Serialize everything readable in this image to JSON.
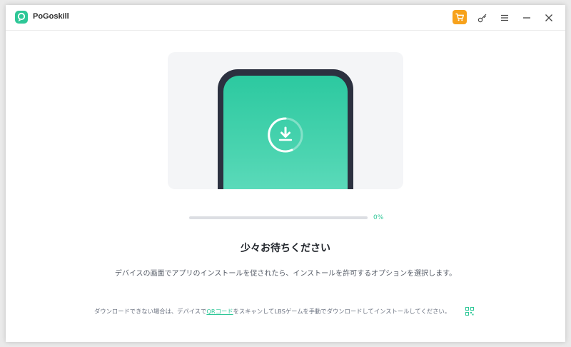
{
  "app": {
    "title": "PoGoskill"
  },
  "titlebar": {
    "icons": [
      "cart-icon",
      "key-icon",
      "menu-icon",
      "minimize-icon",
      "close-icon"
    ],
    "accent_cart": "#f7a21b"
  },
  "progress": {
    "value": 0,
    "text": "0%"
  },
  "main": {
    "heading": "少々お待ちください",
    "description": "デバイスの画面でアプリのインストールを促されたら、インストールを許可するオプションを選択します。"
  },
  "footer": {
    "text_before": "ダウンロードできない場合は、デバイスで",
    "link": "QRコード",
    "text_after": "をスキャンしてLBSゲームを手動でダウンロードしてインストールしてください。"
  },
  "colors": {
    "brand": "#2ec797",
    "phone_frame": "#2c3140",
    "panel_bg": "#f4f5f7"
  }
}
